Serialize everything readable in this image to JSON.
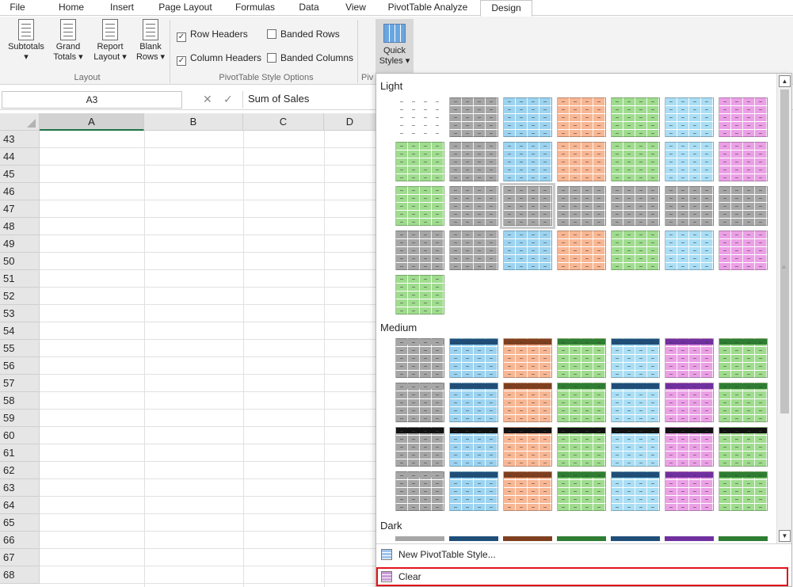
{
  "tabs": [
    {
      "label": "File",
      "active": false
    },
    {
      "label": "Home",
      "active": false
    },
    {
      "label": "Insert",
      "active": false
    },
    {
      "label": "Page Layout",
      "active": false
    },
    {
      "label": "Formulas",
      "active": false
    },
    {
      "label": "Data",
      "active": false
    },
    {
      "label": "View",
      "active": false
    },
    {
      "label": "PivotTable Analyze",
      "active": false
    },
    {
      "label": "Design",
      "active": true
    }
  ],
  "ribbon": {
    "layout": {
      "group_label": "Layout",
      "subtotals": {
        "line1": "Subtotals",
        "line2": "▾"
      },
      "grand_totals": {
        "line1": "Grand",
        "line2": "Totals ▾"
      },
      "report_layout": {
        "line1": "Report",
        "line2": "Layout ▾"
      },
      "blank_rows": {
        "line1": "Blank",
        "line2": "Rows ▾"
      }
    },
    "style_options": {
      "group_label": "PivotTable Style Options",
      "row_headers": {
        "label": "Row Headers",
        "checked": true
      },
      "column_headers": {
        "label": "Column Headers",
        "checked": true
      },
      "banded_rows": {
        "label": "Banded Rows",
        "checked": false
      },
      "banded_columns": {
        "label": "Banded Columns",
        "checked": false
      }
    },
    "styles_group_label_partial": "Piv",
    "quick_styles": {
      "line1": "Quick",
      "line2": "Styles ▾"
    }
  },
  "formula_bar": {
    "name_box": "A3",
    "cancel_glyph": "✕",
    "enter_glyph": "✓",
    "value": "Sum of Sales"
  },
  "grid": {
    "columns": [
      "A",
      "B",
      "C",
      "D"
    ],
    "selected_column": "A",
    "rows": [
      "43",
      "44",
      "45",
      "46",
      "47",
      "48",
      "49",
      "50",
      "51",
      "52",
      "53",
      "54",
      "55",
      "56",
      "57",
      "58",
      "59",
      "60",
      "61",
      "62",
      "63",
      "64",
      "65",
      "66",
      "67",
      "68"
    ]
  },
  "gallery": {
    "sections": {
      "light": "Light",
      "medium": "Medium",
      "dark": "Dark"
    },
    "palette": {
      "none": "#ffffff",
      "gray": "#a6a6a6",
      "blue": "#9bd3f0",
      "orange": "#f8b693",
      "green": "#9fdc8e",
      "cyan": "#a9def5",
      "pink": "#eba0e6",
      "navy": "#1f4e79",
      "black": "#111111",
      "darkgreen": "#2e7d32",
      "brown": "#7f3f1f",
      "purple": "#7030a0"
    },
    "footer": {
      "new_style": "New PivotTable Style...",
      "clear": "Clear"
    },
    "highlight_color": "#e1141a"
  }
}
